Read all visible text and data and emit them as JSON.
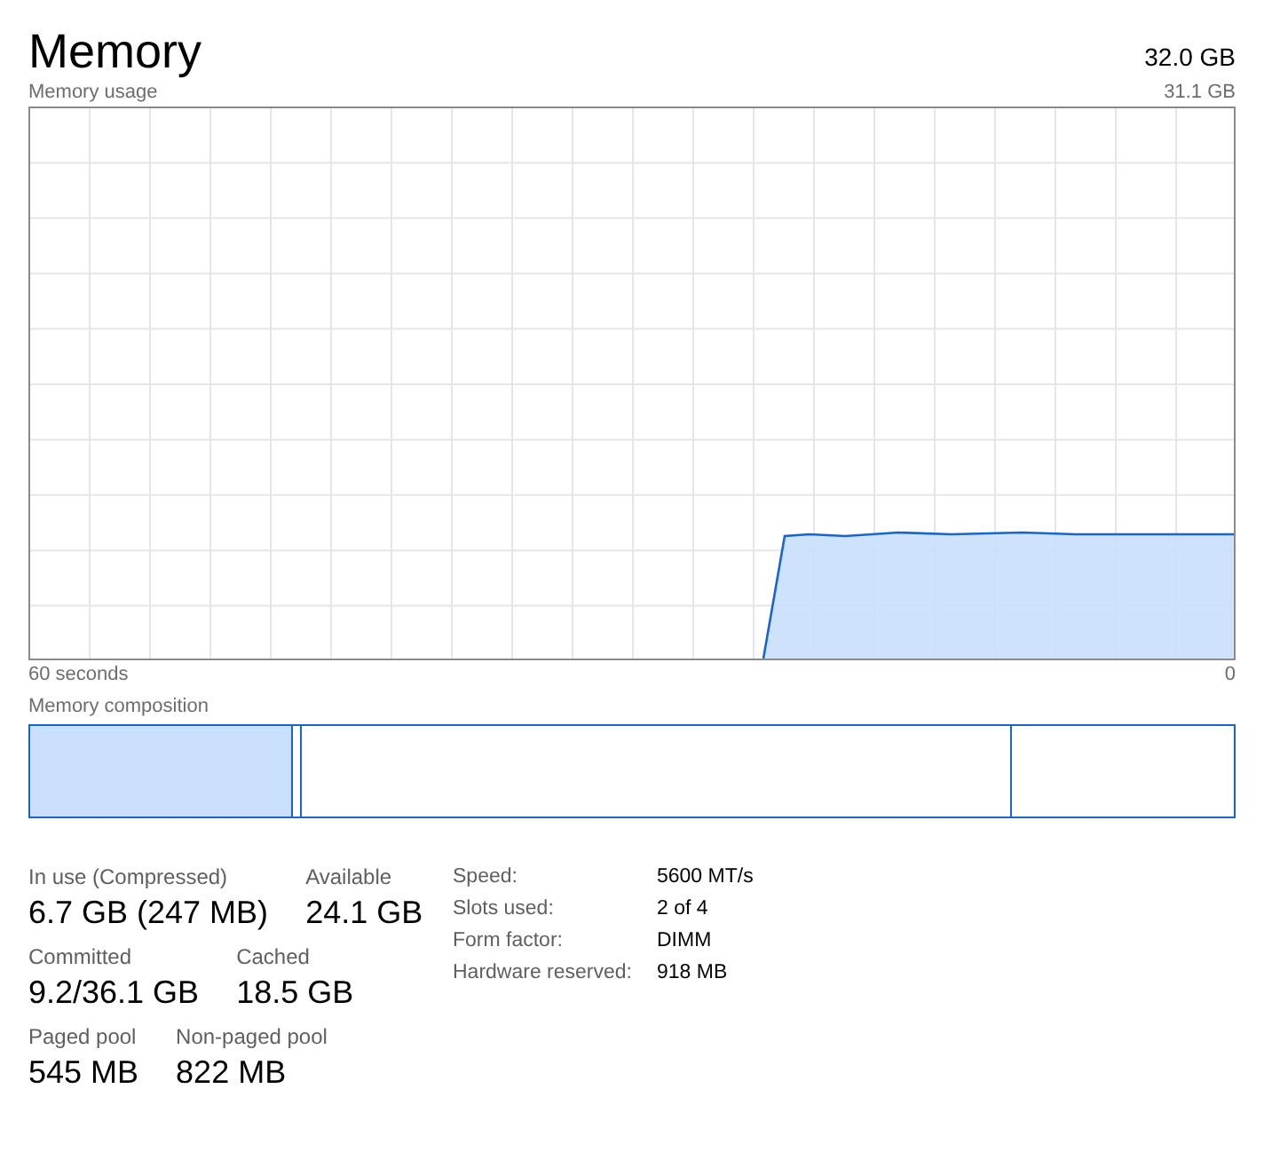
{
  "header": {
    "title": "Memory",
    "total": "32.0 GB"
  },
  "usage_chart": {
    "label": "Memory usage",
    "max": "31.1 GB",
    "x_start": "60 seconds",
    "x_end": "0"
  },
  "composition": {
    "label": "Memory composition"
  },
  "stats": [
    [
      {
        "label": "In use (Compressed)",
        "value": "6.7 GB (247 MB)"
      },
      {
        "label": "Available",
        "value": "24.1 GB"
      }
    ],
    [
      {
        "label": "Committed",
        "value": "9.2/36.1 GB"
      },
      {
        "label": "Cached",
        "value": "18.5 GB"
      }
    ],
    [
      {
        "label": "Paged pool",
        "value": "545 MB"
      },
      {
        "label": "Non-paged pool",
        "value": "822 MB"
      }
    ]
  ],
  "properties": [
    {
      "label": "Speed:",
      "value": "5600 MT/s"
    },
    {
      "label": "Slots used:",
      "value": "2 of 4"
    },
    {
      "label": "Form factor:",
      "value": "DIMM"
    },
    {
      "label": "Hardware reserved:",
      "value": "918 MB"
    }
  ]
}
